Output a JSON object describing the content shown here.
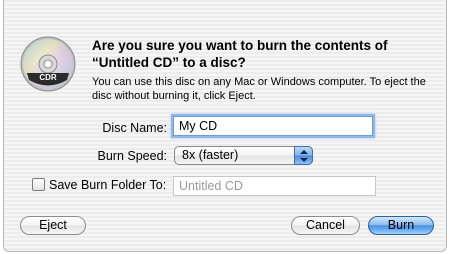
{
  "dialog": {
    "title": "Are you sure you want to burn the contents of “Untitled CD” to a disc?",
    "description": "You can use this disc on any Mac or Windows computer. To eject the disc without burning it, click Eject.",
    "icon": {
      "name": "cd-r-disc-icon",
      "label": "CDR"
    }
  },
  "form": {
    "disc_name_label": "Disc Name:",
    "disc_name_value": "My CD",
    "burn_speed_label": "Burn Speed:",
    "burn_speed_value": "8x (faster)",
    "save_folder_label": "Save Burn Folder To:",
    "save_folder_checked": false,
    "save_folder_value": "Untitled CD"
  },
  "buttons": {
    "eject_label": "Eject",
    "cancel_label": "Cancel",
    "burn_label": "Burn"
  },
  "colors": {
    "default_button": "#4e92e0",
    "focus_ring": "#8fb8e8"
  }
}
